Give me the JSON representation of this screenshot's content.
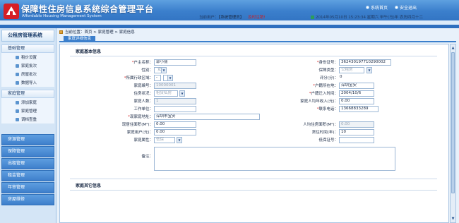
{
  "header": {
    "title": "保障性住房信息系统综合管理平台",
    "subtitle": "Affordable Housing Management System",
    "links": [
      {
        "label": "系统首页"
      },
      {
        "label": "安全退出"
      }
    ],
    "user_prefix": "当前用户：",
    "user_role": "【系统管理员】",
    "logout": "及时注销!",
    "time": "2014年05月10日 15:23:34 星期六 甲午(马)年 农历四月十二"
  },
  "sidebar": {
    "title": "公租房管理系统",
    "groups": [
      {
        "label": "基础管理",
        "items": [
          {
            "label": "租价设置"
          },
          {
            "label": "家庭批次"
          },
          {
            "label": "房屋批次"
          },
          {
            "label": "数据导入"
          }
        ]
      },
      {
        "label": "家庭管理",
        "items": [
          {
            "label": "添加家庭"
          },
          {
            "label": "家庭管理"
          },
          {
            "label": "调档查重"
          }
        ]
      }
    ],
    "closed_groups": [
      {
        "label": "房源管理"
      },
      {
        "label": "保障管理"
      },
      {
        "label": "出租管理"
      },
      {
        "label": "租金管理"
      },
      {
        "label": "年审管理"
      },
      {
        "label": "房屋维修"
      }
    ]
  },
  "main": {
    "breadcrumb": "当前位置：首页 > 家庭管理 > 家庭信息",
    "tab": "家庭详细信息",
    "section_basic": "家庭基本信息",
    "section_other": "家庭其它信息",
    "form": {
      "head_name": {
        "label": "户主名称：",
        "value": "郭小丽"
      },
      "id_no": {
        "label": "身份证号：",
        "value": "362430197710290002"
      },
      "gender": {
        "label": "性别：",
        "value": "女"
      },
      "guarantee": {
        "label": "保障类型：",
        "value": "公租房"
      },
      "district": {
        "label": "所属行政区域：",
        "value": "-"
      },
      "score": {
        "label": "评分(分)：",
        "value": "0"
      },
      "family_no": {
        "label": "家庭编号：",
        "value": "10000001"
      },
      "household_reg": {
        "label": "户籍所在地：",
        "value": "深圳宝安"
      },
      "housing_status": {
        "label": "住房状况：",
        "value": "租赁私房"
      },
      "move_date": {
        "label": "户籍迁入时间：",
        "value": "2004/10/6"
      },
      "member_count": {
        "label": "家庭人数：",
        "value": "1"
      },
      "income": {
        "label": "家庭人均年收入(元)：",
        "value": "0.00"
      },
      "work_unit": {
        "label": "工作单位：",
        "value": ""
      },
      "phone": {
        "label": "联系电话：",
        "value": "13668833289"
      },
      "address": {
        "label": "现家庭地址：",
        "value": "深圳市宝安"
      },
      "area_now": {
        "label": "现居住面积(M²)：",
        "value": "0.00"
      },
      "area_avg": {
        "label": "人均住房面积(M²)：",
        "value": "0.00"
      },
      "rent_type": {
        "label": "家庭用户(元)：",
        "value": "0.00"
      },
      "residency": {
        "label": "常住时间(年)：",
        "value": "10"
      },
      "attribute": {
        "label": "家庭属性：",
        "value": "低保"
      },
      "certificate": {
        "label": "低保证号：",
        "value": ""
      },
      "remark": {
        "label": "备注：",
        "value": ""
      }
    }
  }
}
